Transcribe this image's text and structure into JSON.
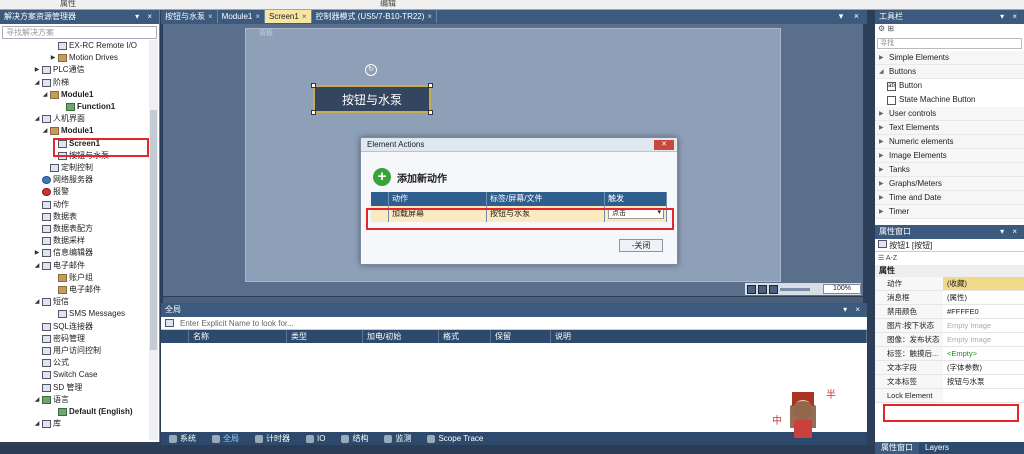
{
  "top_labels": [
    "属性",
    "编辑"
  ],
  "left_panel": {
    "title": "解决方案资源管理器",
    "search_placeholder": "寻找解决方案",
    "tree": [
      {
        "label": "EX-RC Remote I/O",
        "level": 2,
        "arrow": "",
        "icon": "device-icon"
      },
      {
        "label": "Motion Drives",
        "level": 2,
        "arrow": "▶",
        "icon": "folder-icon"
      },
      {
        "label": "PLC通信",
        "level": 0,
        "arrow": "▶",
        "icon": "plc-icon"
      },
      {
        "label": "阶梯",
        "level": 0,
        "arrow": "◢",
        "icon": "ladder-icon"
      },
      {
        "label": "Module1",
        "level": 1,
        "arrow": "◢",
        "icon": "folder-icon",
        "bold": true
      },
      {
        "label": "Function1",
        "level": 3,
        "arrow": "",
        "icon": "function-icon",
        "bold": true
      },
      {
        "label": "人机界面",
        "level": 0,
        "arrow": "◢",
        "icon": "hmi-icon"
      },
      {
        "label": "Module1",
        "level": 1,
        "arrow": "◢",
        "icon": "folder-icon",
        "bold": true
      },
      {
        "label": "Screen1",
        "level": 2,
        "arrow": "",
        "icon": "screen-icon",
        "bold": true
      },
      {
        "label": "按钮与水泵",
        "level": 2,
        "arrow": "",
        "icon": "screen-icon"
      },
      {
        "label": "定制控制",
        "level": 1,
        "arrow": "",
        "icon": "control-icon"
      },
      {
        "label": "网络服务器",
        "level": 0,
        "arrow": "",
        "icon": "globe-icon"
      },
      {
        "label": "报警",
        "level": 0,
        "arrow": "",
        "icon": "alarm-icon"
      },
      {
        "label": "动作",
        "level": 0,
        "arrow": "",
        "icon": "action-icon"
      },
      {
        "label": "数据表",
        "level": 0,
        "arrow": "",
        "icon": "table-icon"
      },
      {
        "label": "数据表配方",
        "level": 0,
        "arrow": "",
        "icon": "recipe-icon"
      },
      {
        "label": "数据采样",
        "level": 0,
        "arrow": "",
        "icon": "sampling-icon"
      },
      {
        "label": "信息编辑器",
        "level": 0,
        "arrow": "▶",
        "icon": "message-icon"
      },
      {
        "label": "电子邮件",
        "level": 0,
        "arrow": "◢",
        "icon": "email-icon"
      },
      {
        "label": "账户组",
        "level": 2,
        "arrow": "",
        "icon": "folder-icon"
      },
      {
        "label": "电子邮件",
        "level": 2,
        "arrow": "",
        "icon": "folder-icon"
      },
      {
        "label": "短信",
        "level": 0,
        "arrow": "◢",
        "icon": "sms-icon"
      },
      {
        "label": "SMS Messages",
        "level": 2,
        "arrow": "",
        "icon": "sms-icon"
      },
      {
        "label": "SQL连接器",
        "level": 0,
        "arrow": "",
        "icon": "sql-icon"
      },
      {
        "label": "密码管理",
        "level": 0,
        "arrow": "",
        "icon": "password-icon"
      },
      {
        "label": "用户访问控制",
        "level": 0,
        "arrow": "",
        "icon": "user-icon"
      },
      {
        "label": "公式",
        "level": 0,
        "arrow": "",
        "icon": "formula-icon"
      },
      {
        "label": "Switch Case",
        "level": 0,
        "arrow": "",
        "icon": "switch-icon"
      },
      {
        "label": "SD 管理",
        "level": 0,
        "arrow": "",
        "icon": "sd-icon"
      },
      {
        "label": "语言",
        "level": 0,
        "arrow": "◢",
        "icon": "language-icon"
      },
      {
        "label": "Default (English)",
        "level": 2,
        "arrow": "",
        "icon": "language-icon",
        "bold": true
      },
      {
        "label": "库",
        "level": 0,
        "arrow": "◢",
        "icon": "library-icon"
      }
    ]
  },
  "tabs": [
    {
      "label": "按钮与水泵",
      "active": false
    },
    {
      "label": "Module1",
      "active": false
    },
    {
      "label": "Screen1",
      "active": true
    },
    {
      "label": "控制器模式 (US5/7-B10-TR22)",
      "active": false
    }
  ],
  "canvas": {
    "screen_label": "背板",
    "button_text": "按钮与水泵",
    "zoom": "100%"
  },
  "dialog": {
    "title": "Element Actions",
    "add_label": "添加新动作",
    "columns": [
      "",
      "动作",
      "标签/屏幕/文件",
      "触发"
    ],
    "rows": [
      {
        "action": "加载屏幕",
        "target": "按钮与水泵",
        "trigger": "点击"
      }
    ],
    "close_label": "关闭"
  },
  "bottom_panel": {
    "title": "全局",
    "input_placeholder": "Enter Explicit Name to look for...",
    "columns": [
      "名称",
      "类型",
      "加电/初始",
      "格式",
      "保留",
      "说明"
    ]
  },
  "bottom_tabs": [
    "系统",
    "全局",
    "计时器",
    "IO",
    "结构",
    "监测",
    "Scope Trace"
  ],
  "toolbox": {
    "title": "工具栏",
    "search_placeholder": "寻找",
    "items": [
      {
        "label": "Simple Elements",
        "type": "group"
      },
      {
        "label": "Buttons",
        "type": "group-open"
      },
      {
        "label": "Button",
        "type": "sub"
      },
      {
        "label": "State Machine Button",
        "type": "sub"
      },
      {
        "label": "User controls",
        "type": "group"
      },
      {
        "label": "Text Elements",
        "type": "group"
      },
      {
        "label": "Numeric elements",
        "type": "group"
      },
      {
        "label": "Image Elements",
        "type": "group"
      },
      {
        "label": "Tanks",
        "type": "group"
      },
      {
        "label": "Graphs/Meters",
        "type": "group"
      },
      {
        "label": "Time and Date",
        "type": "group"
      },
      {
        "label": "Timer",
        "type": "group"
      }
    ]
  },
  "properties": {
    "title": "属性窗口",
    "object": "按钮1 [按钮]",
    "section": "属性",
    "rows": [
      {
        "key": "动作",
        "value": "(收藏)",
        "style": "hl"
      },
      {
        "key": "消息框",
        "value": "(属性)",
        "style": ""
      },
      {
        "key": "禁用颜色",
        "value": "#FFFFE0",
        "style": ""
      },
      {
        "key": "图片:按下状态",
        "value": "Empty Image",
        "style": "grey"
      },
      {
        "key": "图像：发布状态",
        "value": "Empty Image",
        "style": "grey"
      },
      {
        "key": "标签：触摸后...",
        "value": "<Empty>",
        "style": "green"
      },
      {
        "key": "文本字段",
        "value": "(字体参数)",
        "style": ""
      },
      {
        "key": "文本标签",
        "value": "按钮与水泵",
        "style": ""
      },
      {
        "key": "Lock Element",
        "value": "",
        "style": ""
      }
    ],
    "tabs": [
      "属性窗口",
      "Layers"
    ]
  }
}
